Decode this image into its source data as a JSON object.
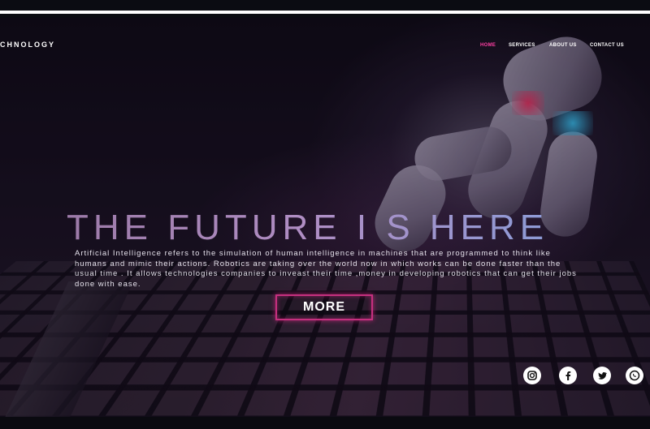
{
  "brand": {
    "name": "CHNOLOGY"
  },
  "nav": {
    "items": [
      {
        "label": "HOME",
        "active": true
      },
      {
        "label": "SERVICES",
        "active": false
      },
      {
        "label": "ABOUT US",
        "active": false
      },
      {
        "label": "CONTACT US",
        "active": false
      }
    ]
  },
  "hero": {
    "headline": "THE FUTURE I S HERE",
    "paragraph": "Artificial Intelligence refers to the simulation of human intelligence in machines that are programmed to think like humans and mimic their actions. Robotics are taking over the world now in which works can be done faster than the usual time . It allows technologies companies to inveast their time ,money in developing robotics that can get their jobs done with ease.",
    "cta_label": "MORE"
  },
  "social": {
    "icons": [
      "instagram-icon",
      "facebook-icon",
      "twitter-icon",
      "whatsapp-icon"
    ]
  },
  "colors": {
    "accent": "#ff3fa4",
    "button_border": "#c5307f",
    "background": "#0a0a10",
    "text": "#ffffff"
  }
}
